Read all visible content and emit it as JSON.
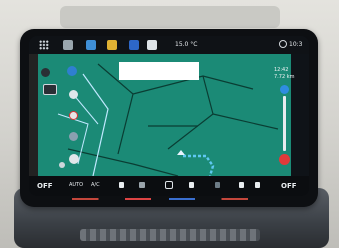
{
  "topbar": {
    "temperature": "15.0 °C",
    "clock": "10:3"
  },
  "navigation": {
    "eta_time": "12:42",
    "eta_distance": "7.72 km"
  },
  "bottombar": {
    "left_off": "OFF",
    "auto_label": "AUTO",
    "ac_label": "A/C",
    "right_off": "OFF"
  },
  "colors": {
    "map_background": "#1b8a76",
    "route_blue": "#5fc8f2",
    "close_button": "#e03a3a",
    "nav_dot": "#2f8de0"
  }
}
